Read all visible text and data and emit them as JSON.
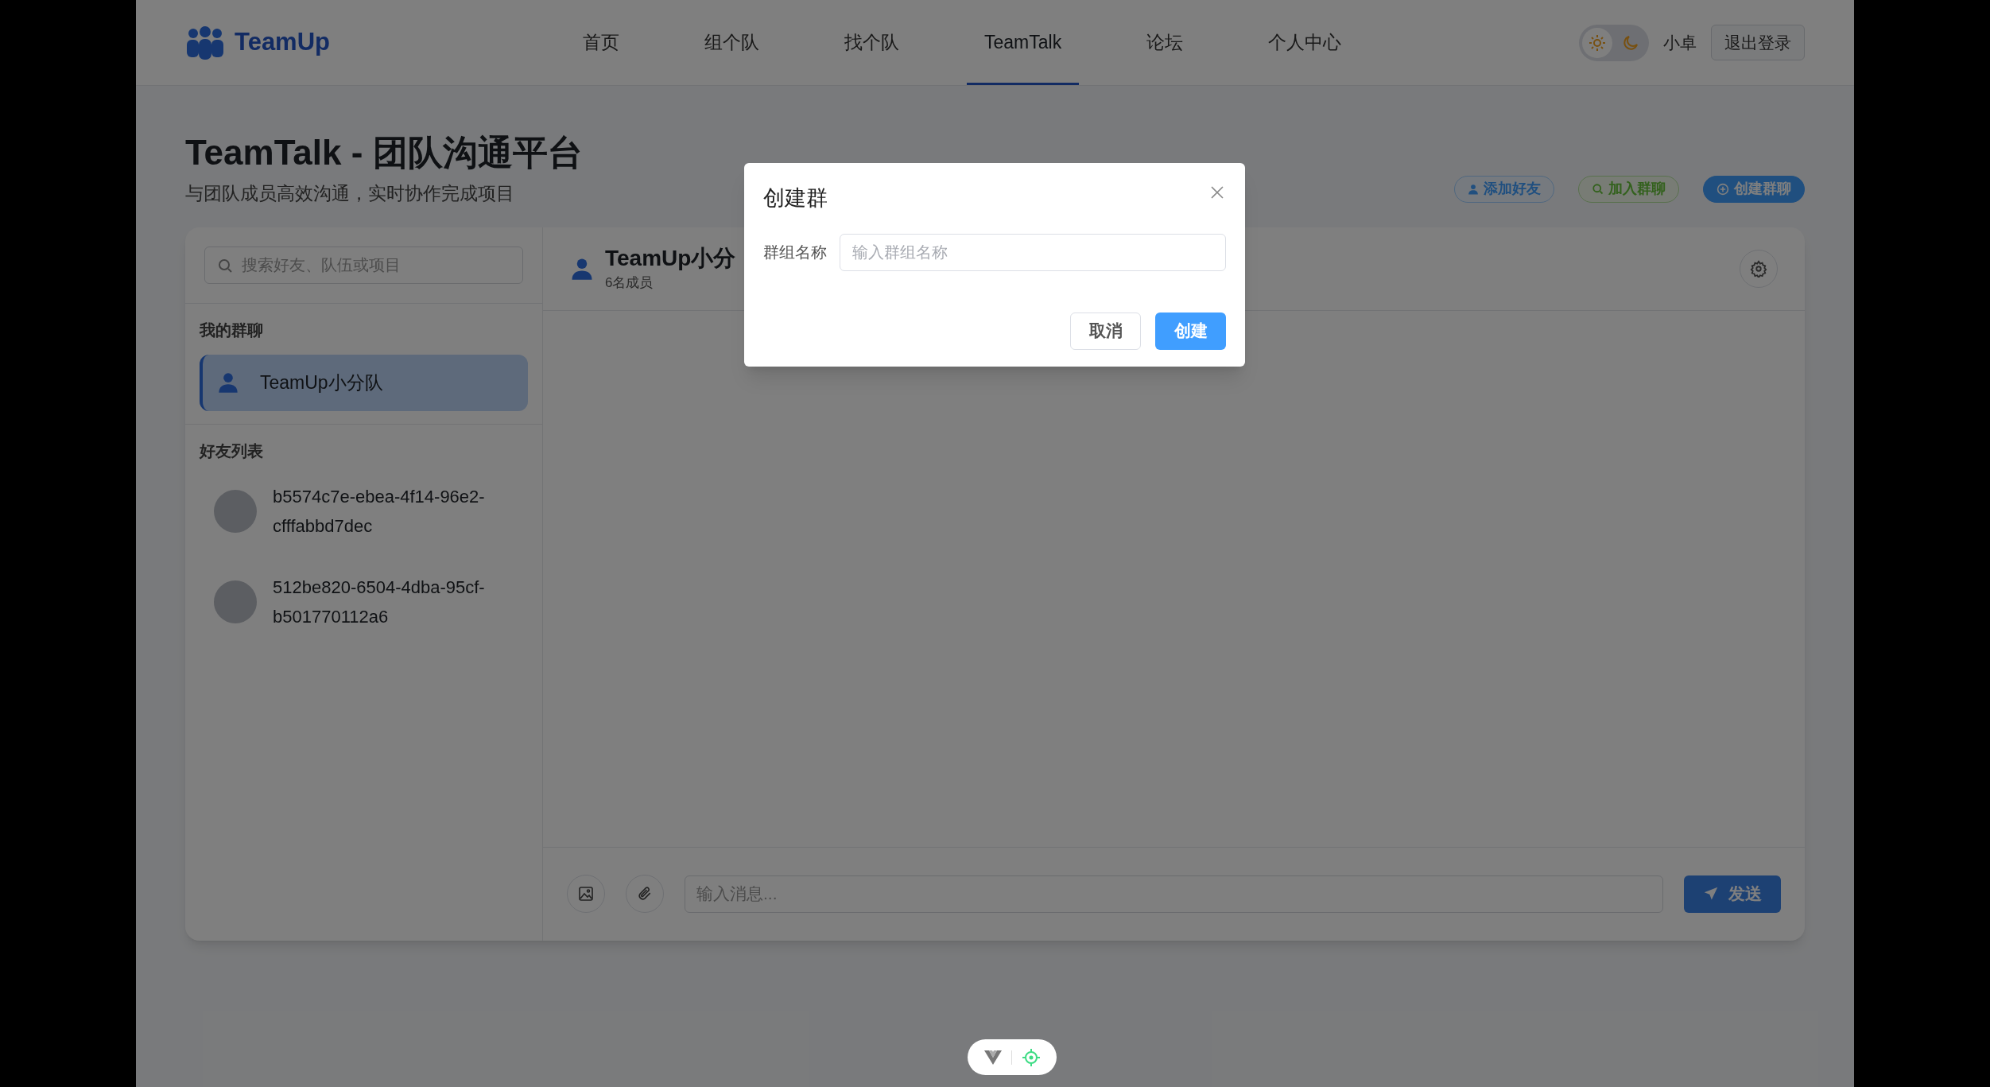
{
  "header": {
    "logo": "TeamUp",
    "nav": [
      {
        "label": "首页",
        "selected": false
      },
      {
        "label": "组个队",
        "selected": false
      },
      {
        "label": "找个队",
        "selected": false
      },
      {
        "label": "TeamTalk",
        "selected": true
      },
      {
        "label": "论坛",
        "selected": false
      },
      {
        "label": "个人中心",
        "selected": false
      }
    ],
    "dark_mode": false,
    "user": "小卓",
    "logout": "退出登录"
  },
  "page": {
    "title": "TeamTalk - 团队沟通平台",
    "subtitle": "与团队成员高效沟通，实时协作完成项目",
    "actions": [
      {
        "label": "添加好友",
        "kind": "friend"
      },
      {
        "label": "加入群聊",
        "kind": "join"
      },
      {
        "label": "创建群聊",
        "kind": "create"
      }
    ]
  },
  "sidebar": {
    "search_placeholder": "搜索好友、队伍或项目",
    "groups_heading": "我的群聊",
    "groups": [
      {
        "name": "TeamUp小分队",
        "selected": true
      }
    ],
    "friends_heading": "好友列表",
    "friends": [
      {
        "name": "b5574c7e-ebea-4f14-96e2-cfffabbd7dec"
      },
      {
        "name": "512be820-6504-4dba-95cf-b501770112a6"
      }
    ]
  },
  "chat": {
    "name": "TeamUp小分",
    "members": "6名成员",
    "message_placeholder": "输入消息...",
    "send": "发送"
  },
  "modal": {
    "title": "创建群",
    "field_label": "群组名称",
    "placeholder": "输入群组名称",
    "buttons": [
      {
        "label": "取消",
        "kind": "secondary"
      },
      {
        "label": "创建",
        "kind": "primary"
      }
    ]
  }
}
